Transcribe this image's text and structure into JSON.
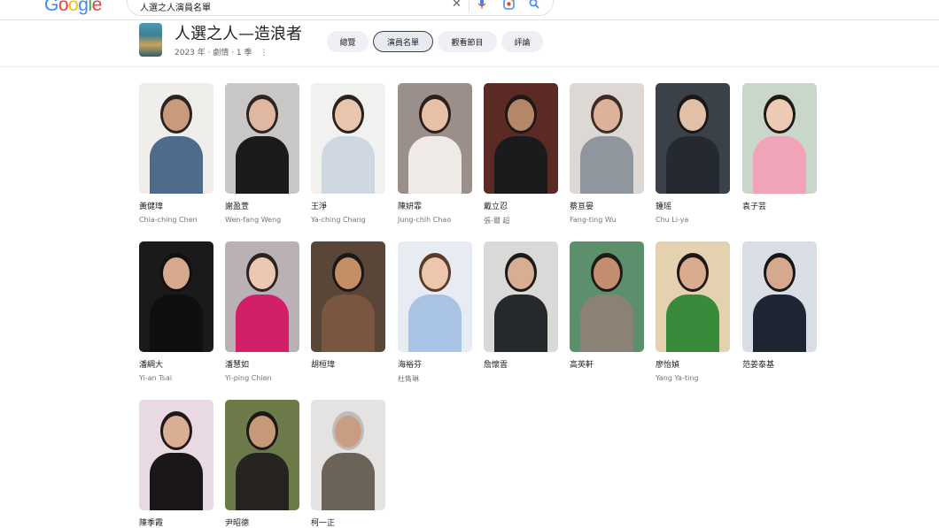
{
  "search": {
    "logo": [
      "G",
      "o",
      "o",
      "g",
      "l",
      "e"
    ],
    "query": "人選之人演員名單"
  },
  "show": {
    "title": "人選之人—造浪者",
    "subtitle": "2023 年 · 劇情 · 1 季"
  },
  "tabs": [
    {
      "label": "總覽"
    },
    {
      "label": "演員名單"
    },
    {
      "label": "觀看節目"
    },
    {
      "label": "評論"
    }
  ],
  "cast": [
    {
      "name": "黃健瑋",
      "role": "Chia-ching Chen",
      "bg": "#efeeea",
      "hair": "#2b2321",
      "skin": "#c99a7c",
      "cloth": "#4f6b8c"
    },
    {
      "name": "謝盈萱",
      "role": "Wen-fang Weng",
      "bg": "#c9c6c6",
      "hair": "#2b2420",
      "skin": "#e0b7a0",
      "cloth": "#1b1b1b"
    },
    {
      "name": "王淨",
      "role": "Ya-ching Chang",
      "bg": "#f1f1ef",
      "hair": "#2a221f",
      "skin": "#e8c5ad",
      "cloth": "#cfd8e2"
    },
    {
      "name": "陳妍霏",
      "role": "Jung-chih Chao",
      "bg": "#9a8f8a",
      "hair": "#2c201b",
      "skin": "#e7c0a8",
      "cloth": "#efeae5"
    },
    {
      "name": "戴立忍",
      "role": "張-爾 超",
      "bg": "#5b2a24",
      "hair": "#1d1816",
      "skin": "#b58769",
      "cloth": "#1b1b1d"
    },
    {
      "name": "蔡亘晏",
      "role": "Fang-ting Wu",
      "bg": "#ddd8d3",
      "hair": "#3d2b2a",
      "skin": "#dcb29a",
      "cloth": "#8f969e"
    },
    {
      "name": "鍾瑶",
      "role": "Chu Li-ya",
      "bg": "#3a4148",
      "hair": "#1a1716",
      "skin": "#e0c0a7",
      "cloth": "#252a30"
    },
    {
      "name": "袁子芸",
      "role": "",
      "bg": "#c8d7c9",
      "hair": "#201a17",
      "skin": "#eccbb4",
      "cloth": "#f1a3b7"
    },
    {
      "name": "潘綱大",
      "role": "Yi-an Tsai",
      "bg": "#1a1a1a",
      "hair": "#121010",
      "skin": "#d6a98c",
      "cloth": "#0f0f0f"
    },
    {
      "name": "潘慧如",
      "role": "Yi-ping Chien",
      "bg": "#b9b1b4",
      "hair": "#2c221f",
      "skin": "#edc8b1",
      "cloth": "#d21f6a"
    },
    {
      "name": "胡桓瑋",
      "role": "",
      "bg": "#5a4638",
      "hair": "#1b1715",
      "skin": "#c48e66",
      "cloth": "#7a5540"
    },
    {
      "name": "海裕芬",
      "role": "杜雋琳",
      "bg": "#e6ecf1",
      "hair": "#5a3b2a",
      "skin": "#ecc6ad",
      "cloth": "#a9c3e4"
    },
    {
      "name": "詹懷雲",
      "role": "",
      "bg": "#d9d9d7",
      "hair": "#1a1818",
      "skin": "#d8ae93",
      "cloth": "#26292b"
    },
    {
      "name": "高英軒",
      "role": "",
      "bg": "#5c8f6c",
      "hair": "#1d1a18",
      "skin": "#c28e6f",
      "cloth": "#8b8275"
    },
    {
      "name": "廖怡媜",
      "role": "Yang Ya-ting",
      "bg": "#e3d1b0",
      "hair": "#1d1816",
      "skin": "#d8ac8d",
      "cloth": "#3a8a3c"
    },
    {
      "name": "范姜泰基",
      "role": "",
      "bg": "#d9dee4",
      "hair": "#191616",
      "skin": "#d5a98d",
      "cloth": "#1e2634"
    },
    {
      "name": "陳季霞",
      "role": "",
      "bg": "#e8d9e2",
      "hair": "#20191a",
      "skin": "#d9ae93",
      "cloth": "#1b1718"
    },
    {
      "name": "尹昭德",
      "role": "",
      "bg": "#6c7a4a",
      "hair": "#1c1816",
      "skin": "#c69a78",
      "cloth": "#27241f"
    },
    {
      "name": "柯一正",
      "role": "",
      "bg": "#e4e3e1",
      "hair": "#bfbdbb",
      "skin": "#c99d82",
      "cloth": "#6b6358"
    }
  ]
}
